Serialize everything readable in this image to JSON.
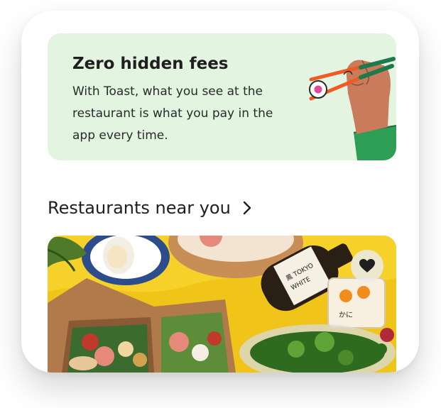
{
  "promo": {
    "title": "Zero hidden fees",
    "body": "With Toast, what you see at the restaurant is what you pay in the app every time.",
    "illustration_icon": "hand-chopsticks-sushi"
  },
  "section": {
    "title": "Restaurants near you",
    "arrow_icon": "chevron-right-icon"
  },
  "restaurant": {
    "photo_icon": "food-photo",
    "favorite_icon": "heart-icon"
  },
  "colors": {
    "promo_bg": "#e3f5e1",
    "accent_orange": "#f05a23",
    "sleeve_green": "#2e9e57",
    "heart": "#1f1f1f"
  }
}
